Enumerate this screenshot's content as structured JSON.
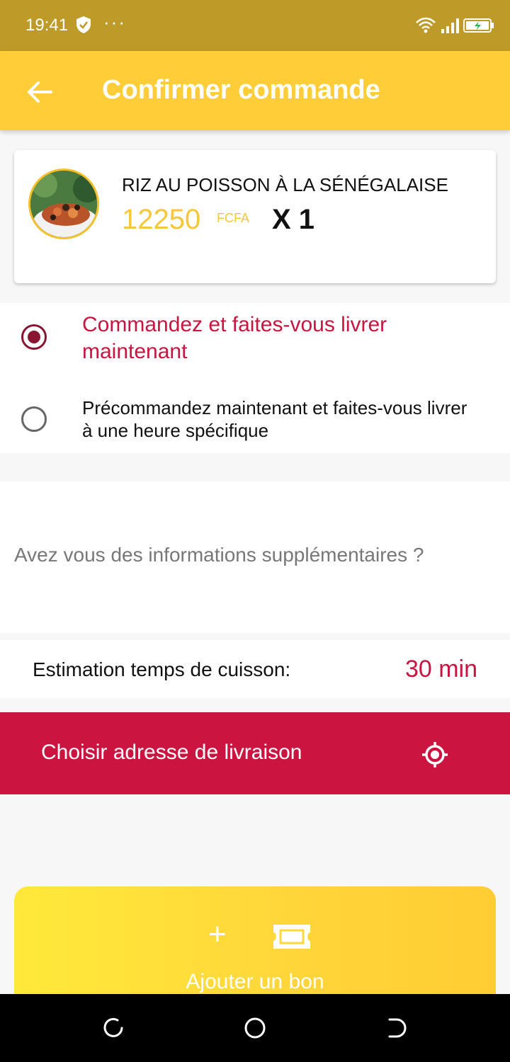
{
  "status_bar": {
    "time": "19:41",
    "dots": "···"
  },
  "app_bar": {
    "title": "Confirmer commande"
  },
  "order_item": {
    "name": "RIZ AU POISSON À LA SÉNÉGALAISE",
    "price": "12250",
    "currency": "FCFA",
    "quantity": "X 1"
  },
  "delivery_options": [
    {
      "label": "Commandez et faites-vous livrer maintenant",
      "selected": true
    },
    {
      "label": "Précommandez maintenant et faites-vous livrer à une heure spécifique",
      "selected": false
    }
  ],
  "additional_info": {
    "placeholder": "Avez vous des informations supplémentaires ?"
  },
  "estimate": {
    "label": "Estimation temps de cuisson:",
    "value": "30 min"
  },
  "address_button": {
    "label": "Choisir adresse de livraison"
  },
  "voucher": {
    "plus": "+",
    "label": "Ajouter un bon"
  },
  "colors": {
    "primary_yellow": "#ffcd38",
    "accent_red": "#cb1540",
    "radio_selected": "#8a1530"
  }
}
